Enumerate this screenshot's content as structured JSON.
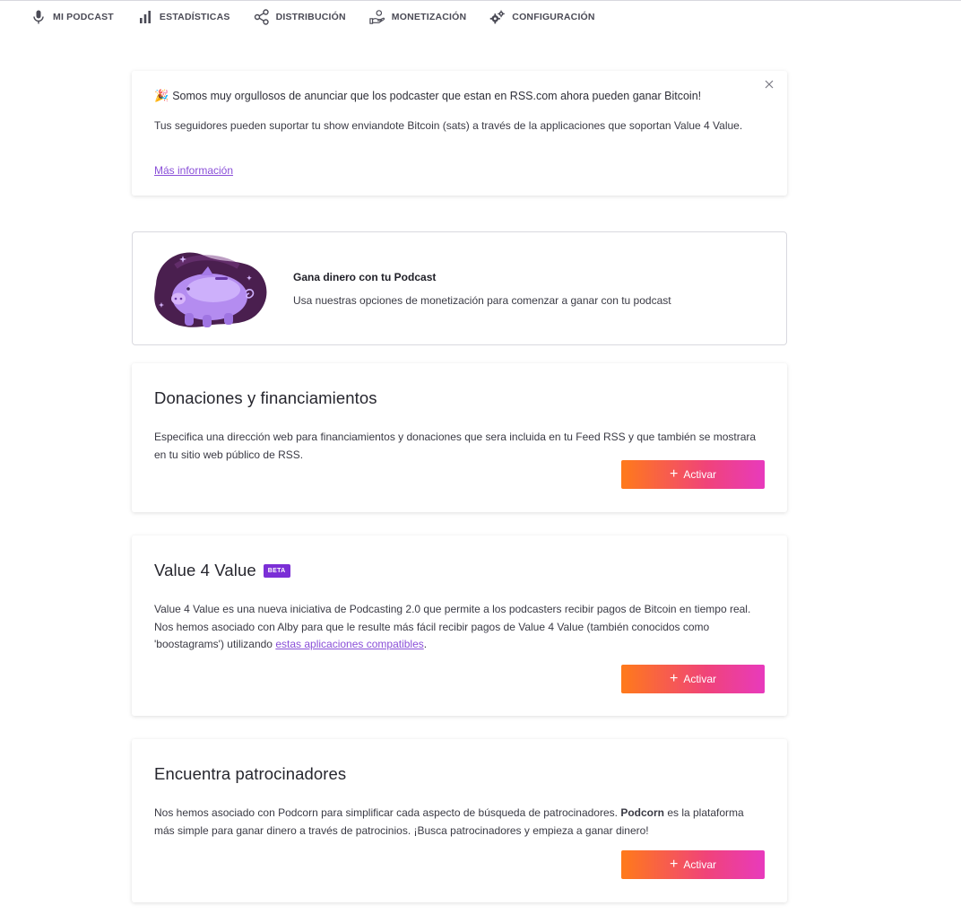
{
  "nav": {
    "items": [
      {
        "label": "MI PODCAST",
        "icon": "microphone-icon"
      },
      {
        "label": "ESTADÍSTICAS",
        "icon": "bar-chart-icon"
      },
      {
        "label": "DISTRIBUCIÓN",
        "icon": "share-icon"
      },
      {
        "label": "MONETIZACIÓN",
        "icon": "hand-coin-icon"
      },
      {
        "label": "CONFIGURACIÓN",
        "icon": "gears-icon"
      }
    ]
  },
  "announcement": {
    "emoji": "🎉",
    "headline": "Somos muy orgullosos de anunciar que los podcaster que estan en RSS.com ahora pueden ganar Bitcoin!",
    "body": "Tus seguidores pueden suportar tu show enviandote Bitcoin (sats) a través de la applicaciones que soportan Value 4 Value.",
    "link": "Más información"
  },
  "promo": {
    "title": "Gana dinero con tu Podcast",
    "description": "Usa nuestras opciones de monetización para comenzar a ganar con tu podcast"
  },
  "donations": {
    "title": "Donaciones y financiamientos",
    "description": "Especifica una dirección web para financiamientos y donaciones que sera incluida en tu Feed RSS y que también se mostrara en tu sitio web público de RSS.",
    "button": "Activar"
  },
  "v4v": {
    "title": "Value 4 Value",
    "badge": "BETA",
    "description": "Value 4 Value es una nueva iniciativa de Podcasting 2.0 que permite a los podcasters recibir pagos de Bitcoin en tiempo real. Nos hemos asociado con Alby para que le resulte más fácil recibir pagos de Value 4 Value (también conocidos como 'boostagrams') utilizando ",
    "link": "estas aplicaciones compatibles",
    "tail": ".",
    "button": "Activar"
  },
  "sponsors": {
    "title": "Encuentra patrocinadores",
    "description_before": "Nos hemos asociado con Podcorn para simplificar cada aspecto de búsqueda de patrocinadores. ",
    "bold": "Podcorn",
    "description_after": " es la plataforma más simple para ganar dinero a través de patrocinios. ¡Busca patrocinadores y empieza a ganar dinero!",
    "button": "Activar"
  },
  "colors": {
    "accent_purple": "#8a4fd8",
    "badge_purple": "#7b2fd6",
    "button_gradient_start": "#ff7a1a",
    "button_gradient_end": "#e83abd"
  }
}
